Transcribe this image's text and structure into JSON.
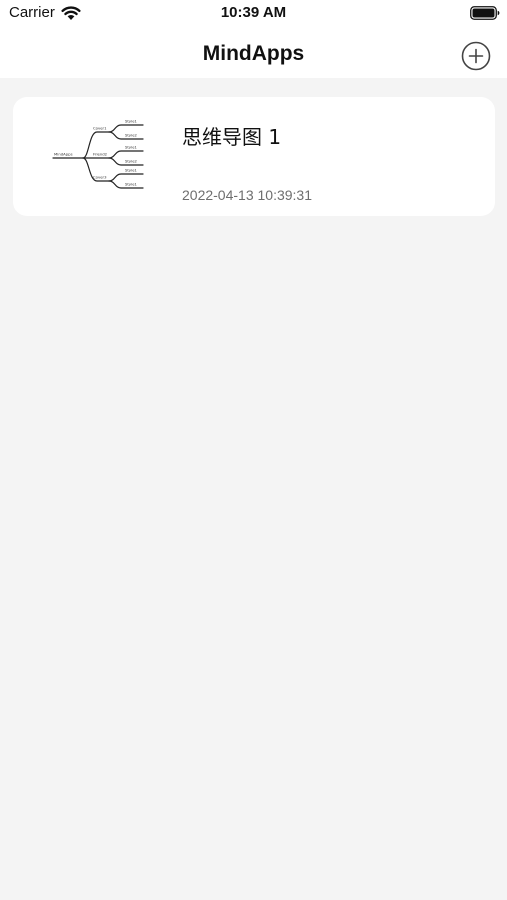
{
  "status_bar": {
    "carrier": "Carrier",
    "time": "10:39 AM",
    "icons": [
      "wifi-icon",
      "battery-icon"
    ]
  },
  "nav": {
    "title": "MindApps",
    "add_icon": "plus-circle-icon"
  },
  "documents": [
    {
      "title": "思维导图 1",
      "date": "2022-04-13 10:39:31",
      "thumbnail": {
        "root": "MindApps",
        "branches": [
          "Cover1",
          "Friend2",
          "Cover3"
        ],
        "leaves": [
          "Style1",
          "Style2",
          "Style1",
          "Style2",
          "Style1",
          "Style1"
        ]
      }
    }
  ],
  "colors": {
    "background": "#f4f4f4",
    "surface": "#ffffff",
    "secondary_text": "#6e6e6e"
  }
}
